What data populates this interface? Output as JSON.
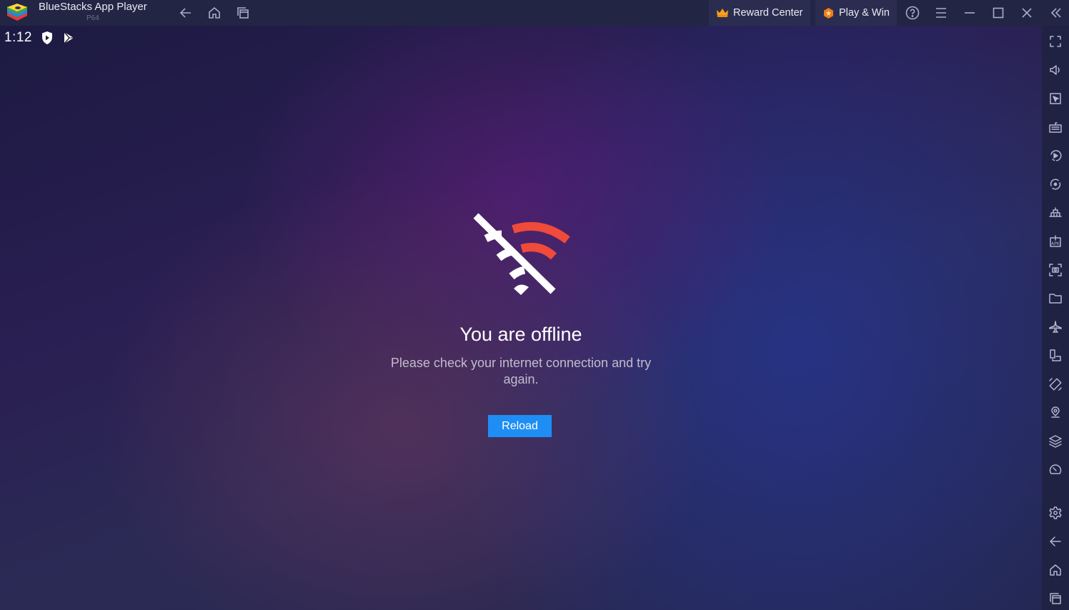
{
  "titlebar": {
    "app_title": "BlueStacks App Player",
    "app_subtitle": "P64",
    "nav_icons": [
      "back-icon",
      "home-icon",
      "recent-apps-icon"
    ],
    "reward_center_label": "Reward Center",
    "play_win_label": "Play & Win",
    "window_icons": [
      "help-icon",
      "menu-icon",
      "minimize-icon",
      "maximize-icon",
      "close-icon",
      "collapse-sidebar-icon"
    ]
  },
  "statusbar": {
    "time": "1:12",
    "icons": [
      "shield-play-icon",
      "play-store-icon"
    ]
  },
  "offline": {
    "icon": "wifi-off-icon",
    "title": "You are offline",
    "message": "Please check your internet connection and try again.",
    "reload_label": "Reload"
  },
  "sidebar": {
    "icons": [
      "fullscreen-icon",
      "volume-icon",
      "pointer-icon",
      "keyboard-icon",
      "macro-play-icon",
      "sync-icon",
      "build-icon",
      "install-apk-icon",
      "screenshot-icon",
      "folder-icon",
      "airplane-icon",
      "multi-instance-icon",
      "rotate-icon",
      "location-icon",
      "layers-icon",
      "performance-icon",
      "settings-icon",
      "back-icon",
      "home-icon",
      "recent-apps-icon"
    ]
  },
  "colors": {
    "accent": "#1e8ef5",
    "wifi_red": "#f04a3a",
    "titlebar_bg": "#222544",
    "sidebar_bg": "#1f2243"
  }
}
